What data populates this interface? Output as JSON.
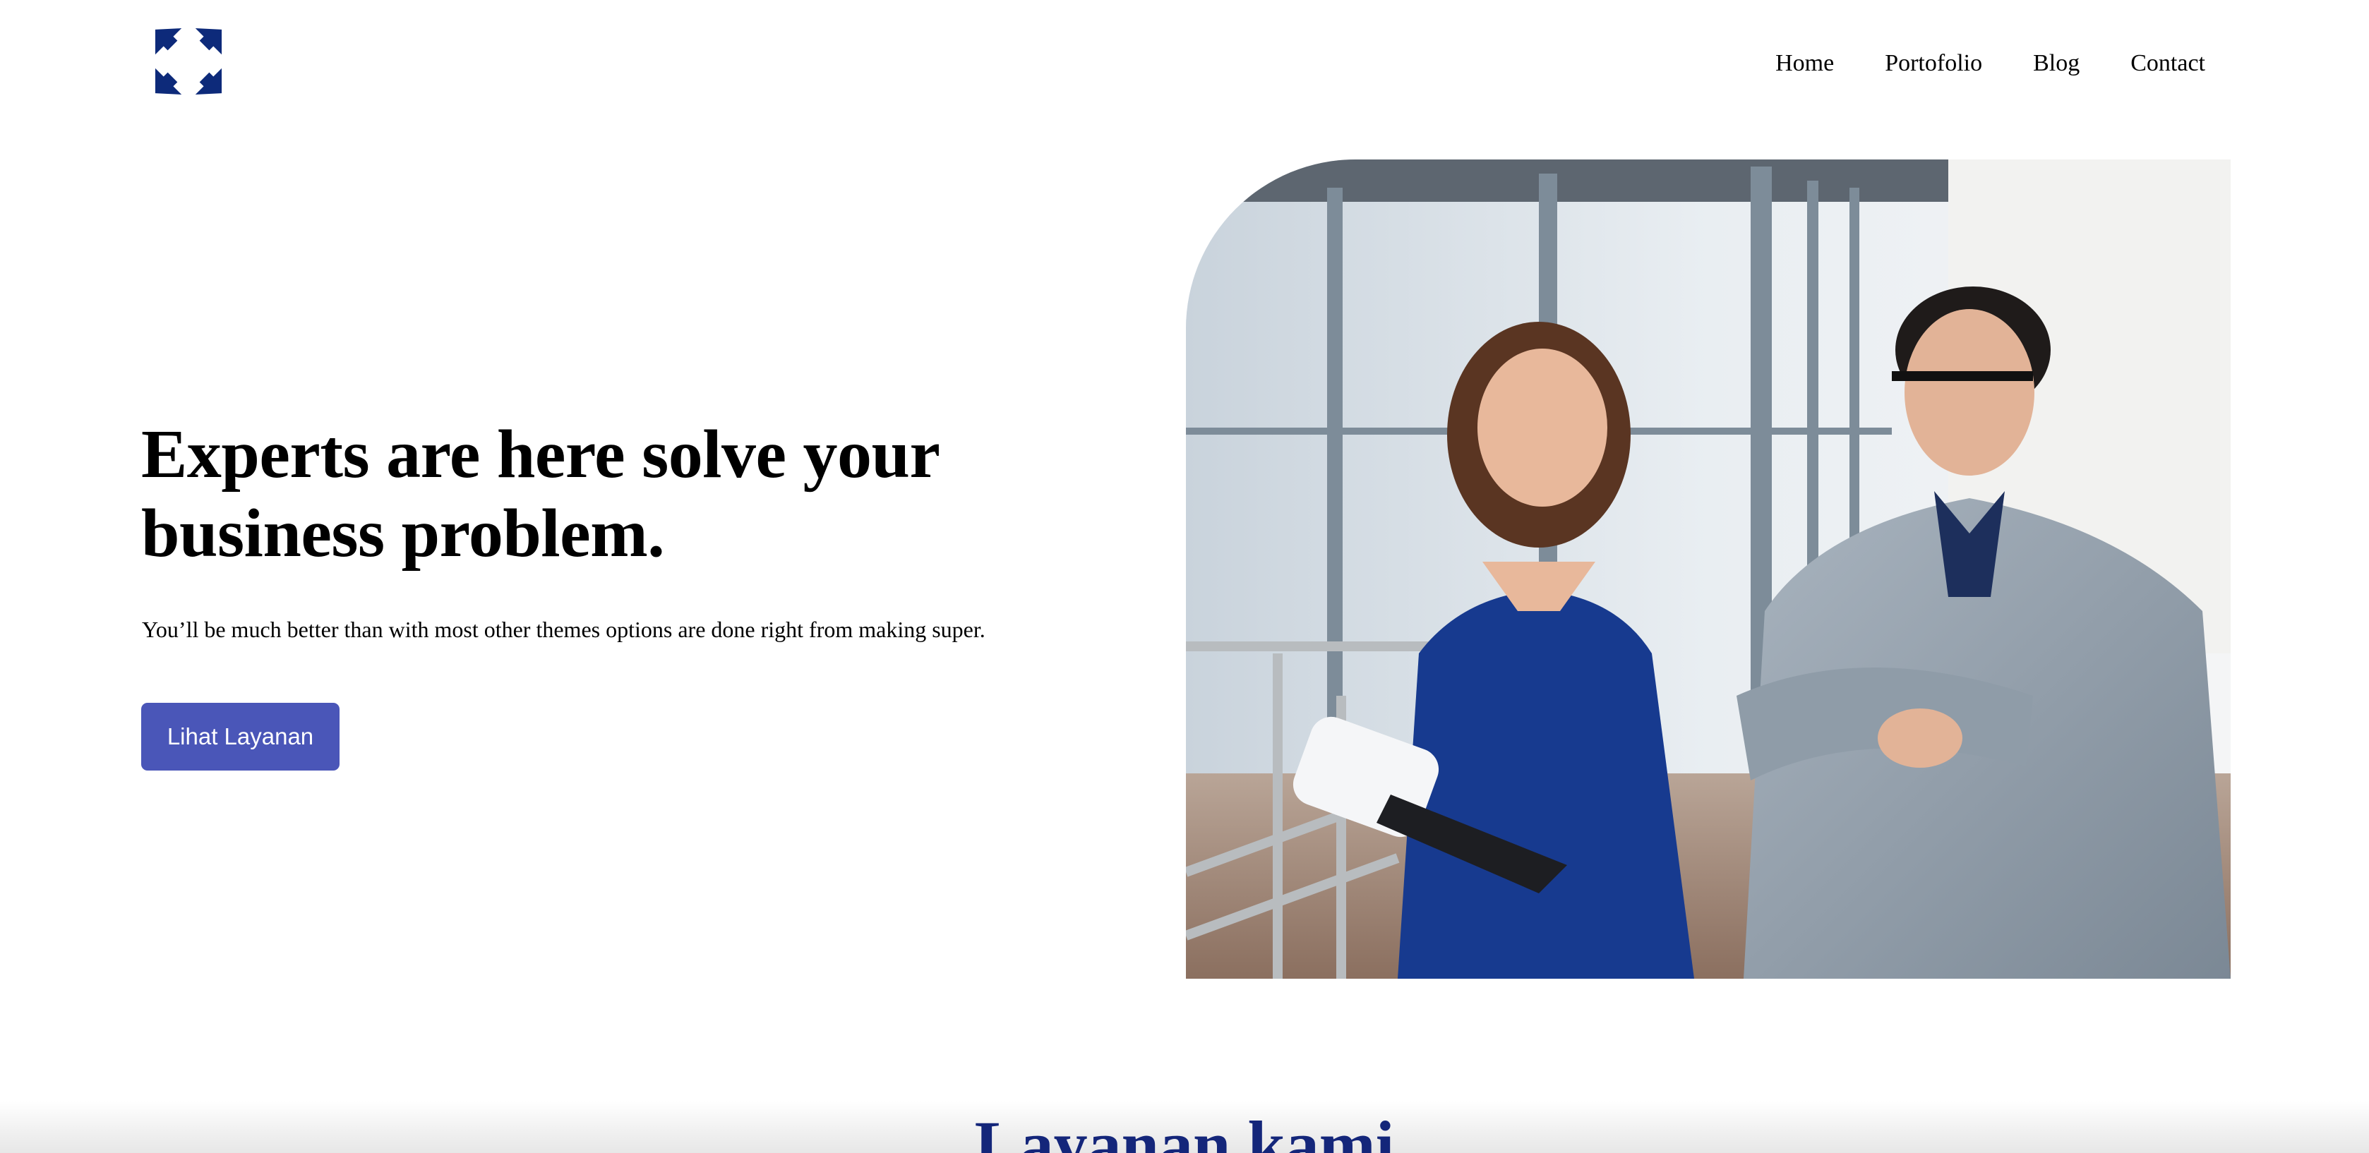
{
  "brand": {
    "logo_icon": "four-arrow-star-logo",
    "logo_color": "#0d2a7a"
  },
  "nav": {
    "items": [
      {
        "label": "Home"
      },
      {
        "label": "Portofolio"
      },
      {
        "label": "Blog"
      },
      {
        "label": "Contact"
      }
    ]
  },
  "hero": {
    "title": "Experts are here solve your business problem.",
    "subtitle": "You’ll be much better than with most other themes options are done right from making super.",
    "cta_label": "Lihat Layanan",
    "cta_color": "#4a56b8",
    "image_icon": "office-team-photo"
  },
  "services": {
    "title": "Layanan kami",
    "title_color": "#14267a"
  }
}
